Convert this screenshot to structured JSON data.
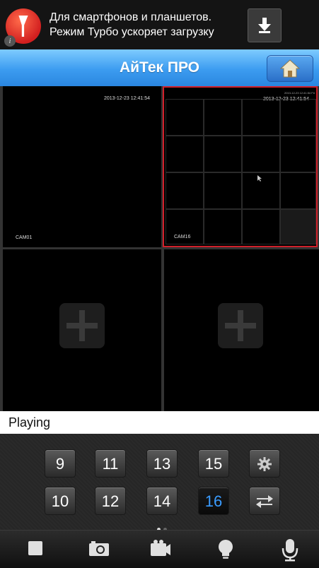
{
  "ad": {
    "line1": "Для смартфонов и планшетов.",
    "line2": "Режим Турбо ускоряет загрузку",
    "logo_icon": "yandex-browser-logo",
    "download_icon": "download-arrow-icon",
    "info_icon": "info-icon",
    "info_glyph": "i"
  },
  "header": {
    "title": "АйТек ПРО",
    "home_icon": "home-icon",
    "color": "#3c9cf0"
  },
  "cameras": {
    "cell1": {
      "timestamp": "2013-12-23 12:41:54",
      "label": "CAM01"
    },
    "cell2": {
      "timestamp": "2013-12-23 12:41:54",
      "label": "CAM16",
      "selected": true,
      "mini_timestamp": "2013-12-23 12:41:54 Fri"
    },
    "cell3": {
      "add_icon": "add-channel-icon"
    },
    "cell4": {
      "add_icon": "add-channel-icon"
    }
  },
  "status": {
    "text": "Playing"
  },
  "channels": {
    "row1": [
      "9",
      "11",
      "13",
      "15"
    ],
    "row2": [
      "10",
      "12",
      "14",
      "16"
    ],
    "active": "16",
    "active_color": "#3a9cff",
    "settings_icon": "gear-icon",
    "switch_icon": "swap-arrows-icon",
    "page_count": 2,
    "current_page": 1
  },
  "toolbar": {
    "items": [
      "stop-icon",
      "snapshot-camera-icon",
      "record-video-icon",
      "lightbulb-icon",
      "microphone-icon"
    ]
  }
}
